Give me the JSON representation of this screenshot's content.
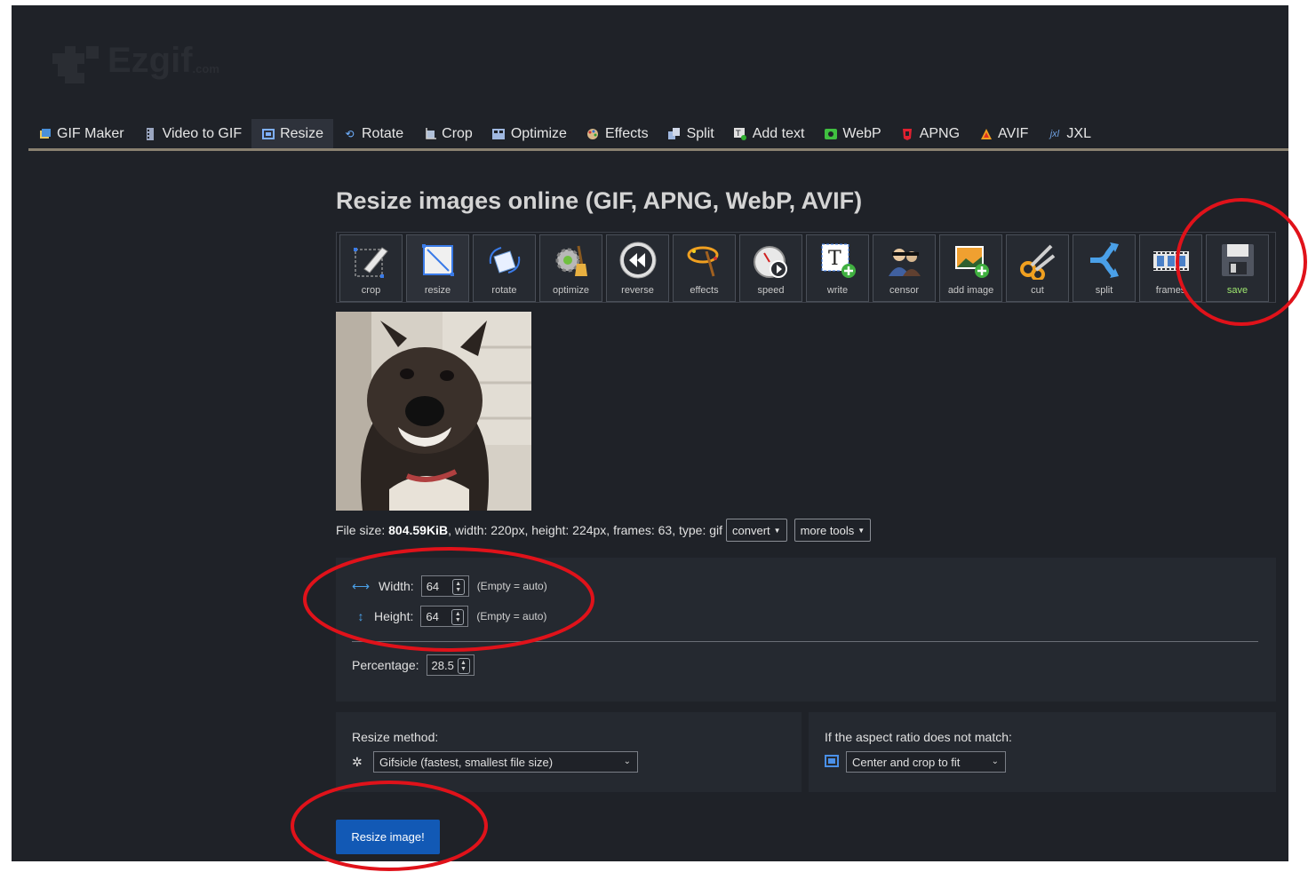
{
  "logo": {
    "name": "Ezgif",
    "suffix": ".com"
  },
  "nav": [
    {
      "label": "GIF Maker",
      "icon": "gif-maker-icon"
    },
    {
      "label": "Video to GIF",
      "icon": "film-icon"
    },
    {
      "label": "Resize",
      "icon": "resize-icon",
      "active": true
    },
    {
      "label": "Rotate",
      "icon": "rotate-icon"
    },
    {
      "label": "Crop",
      "icon": "crop-icon"
    },
    {
      "label": "Optimize",
      "icon": "optimize-icon"
    },
    {
      "label": "Effects",
      "icon": "palette-icon"
    },
    {
      "label": "Split",
      "icon": "split-icon"
    },
    {
      "label": "Add text",
      "icon": "text-icon"
    },
    {
      "label": "WebP",
      "icon": "webp-icon"
    },
    {
      "label": "APNG",
      "icon": "apng-icon"
    },
    {
      "label": "AVIF",
      "icon": "avif-icon"
    },
    {
      "label": "JXL",
      "icon": "jxl-icon"
    }
  ],
  "page_title": "Resize images online (GIF, APNG, WebP, AVIF)",
  "tools": [
    {
      "label": "crop",
      "icon": "crop-tool-icon"
    },
    {
      "label": "resize",
      "icon": "resize-tool-icon",
      "active": true
    },
    {
      "label": "rotate",
      "icon": "rotate-tool-icon"
    },
    {
      "label": "optimize",
      "icon": "optimize-tool-icon"
    },
    {
      "label": "reverse",
      "icon": "reverse-tool-icon"
    },
    {
      "label": "effects",
      "icon": "effects-tool-icon"
    },
    {
      "label": "speed",
      "icon": "speed-tool-icon"
    },
    {
      "label": "write",
      "icon": "write-tool-icon"
    },
    {
      "label": "censor",
      "icon": "censor-tool-icon"
    },
    {
      "label": "add image",
      "icon": "add-image-tool-icon"
    },
    {
      "label": "cut",
      "icon": "cut-tool-icon"
    },
    {
      "label": "split",
      "icon": "split-tool-icon"
    },
    {
      "label": "frames",
      "icon": "frames-tool-icon"
    },
    {
      "label": "save",
      "icon": "save-tool-icon"
    }
  ],
  "preview": {
    "alt": "Smiling dog GIF"
  },
  "fileinfo": {
    "prefix": "File size: ",
    "size": "804.59KiB",
    "rest": ", width: 220px, height: 224px, frames: 63, type: gif",
    "convert_label": "convert",
    "more_tools_label": "more tools"
  },
  "resize": {
    "width_label": "Width:",
    "width_value": "64",
    "height_label": "Height:",
    "height_value": "64",
    "empty_hint": "(Empty = auto)",
    "percentage_label": "Percentage:",
    "percentage_value": "28.5"
  },
  "method": {
    "label": "Resize method:",
    "selected": "Gifsicle (fastest, smallest file size)"
  },
  "aspect": {
    "label": "If the aspect ratio does not match:",
    "selected": "Center and crop to fit"
  },
  "submit_label": "Resize image!",
  "colors": {
    "background": "#1f2228",
    "accent": "#1259b5",
    "annotation": "#e0121a",
    "save_text": "#9fe870"
  }
}
